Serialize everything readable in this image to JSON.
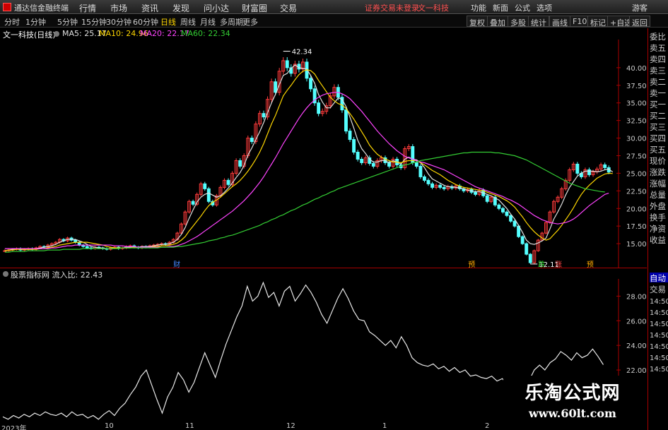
{
  "app": {
    "title": "通达信金融终端",
    "menu": [
      "行情",
      "市场",
      "资讯",
      "发现",
      "问小达",
      "财富圈",
      "交易"
    ],
    "notice": "证券交易未登录",
    "stock_tab": "文一科技",
    "right_menu": [
      "功能",
      "新面",
      "公式",
      "选项"
    ],
    "guest": "游客"
  },
  "toolbar": {
    "periods": [
      "分时",
      "1分钟",
      "5分钟",
      "15分钟",
      "30分钟",
      "60分钟",
      "日线",
      "周线",
      "月线",
      "多周期",
      "更多"
    ],
    "active_period": "日线",
    "buttons": [
      "复权",
      "叠加",
      "多股",
      "统计",
      "画线",
      "F10",
      "标记",
      "+自选",
      "返回"
    ]
  },
  "stock": {
    "name": "文一科技(日线)",
    "ma": [
      {
        "label": "MA5: 25.17",
        "color": "#e0e0e0"
      },
      {
        "label": "MA10: 24.96",
        "color": "#ffd700"
      },
      {
        "label": "MA20: 22.17",
        "color": "#ff44ff"
      },
      {
        "label": "MA60: 22.34",
        "color": "#33cc33"
      }
    ],
    "high_label": "42.34",
    "low_label": "12.11",
    "markers": [
      "财",
      "预",
      "跌",
      "涨",
      "预"
    ]
  },
  "indicator": {
    "header": "股票指标网 流入比: 22.43",
    "y_ticks": [
      "28.00",
      "26.00",
      "24.00",
      "22.00"
    ]
  },
  "right_panel": {
    "items": [
      "委比",
      "卖五",
      "卖四",
      "卖三",
      "卖二",
      "卖一",
      "买一",
      "买二",
      "买三",
      "买四",
      "买五",
      "现价",
      "涨跌",
      "涨幅",
      "总量",
      "外盘",
      "换手",
      "净资",
      "收益"
    ],
    "bottom_items": [
      "自动",
      "交易"
    ],
    "times": [
      "14:50",
      "14:50",
      "14:50",
      "14:50",
      "14:50",
      "14:50",
      "14:50"
    ]
  },
  "dates": [
    "2023年",
    "10",
    "11",
    "12",
    "1",
    "2"
  ],
  "watermark": {
    "title": "乐淘公式网",
    "url": "www.60lt.com"
  },
  "chart_data": [
    {
      "type": "candlestick",
      "title": "文一科技(日线)",
      "y_ticks": [
        15.0,
        17.5,
        20.0,
        22.5,
        25.0,
        27.5,
        30.0,
        32.5,
        35.0,
        37.5,
        40.0
      ],
      "ylim": [
        11.5,
        44.0
      ],
      "annotations": [
        {
          "text": "42.34",
          "y": 42.34
        },
        {
          "text": "12.11",
          "y": 12.11
        }
      ],
      "closes": [
        14.0,
        14.1,
        14.2,
        14.3,
        14.1,
        14.2,
        14.3,
        14.2,
        14.4,
        14.6,
        14.5,
        14.8,
        15.0,
        15.2,
        15.6,
        15.4,
        15.8,
        15.5,
        15.2,
        14.8,
        14.6,
        14.4,
        14.3,
        14.5,
        14.4,
        14.3,
        14.2,
        14.4,
        14.5,
        14.3,
        14.4,
        14.6,
        14.7,
        14.5,
        14.4,
        14.6,
        14.5,
        14.7,
        14.8,
        14.9,
        15.0,
        14.9,
        15.2,
        15.6,
        16.5,
        17.8,
        19.5,
        21.0,
        20.6,
        22.0,
        23.5,
        22.8,
        21.0,
        20.5,
        21.8,
        23.0,
        24.0,
        23.4,
        25.0,
        26.8,
        26.0,
        27.5,
        30.0,
        29.5,
        32.0,
        33.5,
        33.0,
        35.5,
        38.0,
        36.5,
        39.5,
        41.0,
        40.0,
        39.2,
        40.5,
        39.8,
        40.8,
        38.5,
        37.0,
        35.0,
        33.5,
        33.8,
        34.6,
        36.0,
        37.2,
        35.8,
        34.0,
        31.0,
        29.8,
        28.0,
        27.0,
        26.5,
        27.2,
        26.4,
        26.0,
        26.8,
        27.2,
        26.5,
        26.0,
        27.0,
        26.2,
        25.8,
        28.5,
        28.8,
        26.5,
        26.0,
        24.5,
        24.0,
        23.5,
        23.0,
        23.3,
        23.0,
        22.8,
        23.1,
        22.9,
        23.2,
        22.8,
        22.5,
        22.7,
        22.3,
        22.0,
        22.6,
        21.8,
        21.0,
        21.6,
        20.5,
        20.0,
        19.5,
        19.0,
        18.2,
        17.5,
        16.0,
        15.0,
        13.5,
        12.3,
        14.0,
        15.5,
        16.5,
        18.0,
        19.5,
        21.0,
        21.6,
        22.8,
        24.0,
        25.5,
        26.3,
        25.0,
        24.5,
        25.5,
        24.8,
        25.2,
        25.6,
        26.2,
        25.8,
        25.17
      ],
      "series": [
        {
          "name": "MA5",
          "values": [
            14.0,
            14.1,
            14.2,
            14.3,
            14.2,
            14.2,
            14.2,
            14.2,
            14.3,
            14.4,
            14.5,
            14.6,
            14.7,
            14.9,
            15.2,
            15.4,
            15.6,
            15.6,
            15.6,
            15.4,
            15.2,
            14.9,
            14.6,
            14.5,
            14.4,
            14.4,
            14.3,
            14.3,
            14.4,
            14.4,
            14.4,
            14.5,
            14.5,
            14.5,
            14.5,
            14.6,
            14.6,
            14.6,
            14.7,
            14.8,
            14.9,
            14.9,
            15.0,
            15.2,
            15.6,
            16.3,
            17.3,
            18.6,
            19.8,
            20.9,
            21.6,
            22.0,
            22.2,
            21.9,
            21.6,
            21.8,
            22.3,
            22.9,
            23.6,
            24.4,
            25.1,
            26.1,
            27.6,
            28.6,
            29.8,
            30.9,
            32.2,
            33.6,
            35.0,
            36.2,
            37.6,
            38.9,
            39.2,
            39.9,
            40.4,
            40.0,
            39.9,
            39.8,
            38.9,
            37.8,
            36.2,
            35.1,
            34.3,
            34.3,
            35.0,
            35.7,
            35.5,
            34.5,
            33.0,
            31.4,
            29.7,
            28.5,
            27.8,
            27.0,
            26.6,
            26.6,
            26.8,
            26.8,
            26.5,
            26.8,
            26.6,
            26.3,
            27.0,
            27.3,
            27.0,
            26.9,
            26.5,
            25.8,
            24.9,
            24.2,
            23.9,
            23.6,
            23.3,
            23.1,
            23.1,
            23.0,
            22.9,
            22.8,
            22.6,
            22.5,
            22.4,
            22.4,
            22.2,
            22.0,
            21.8,
            21.5,
            21.2,
            20.6,
            20.0,
            19.2,
            18.5,
            17.6,
            16.6,
            15.5,
            15.0,
            14.9,
            15.1,
            15.4,
            15.8,
            17.1,
            18.5,
            19.5,
            20.6,
            21.9,
            23.0,
            23.8,
            24.6,
            25.0,
            25.3,
            25.3,
            25.3,
            25.2,
            25.3,
            25.5,
            25.6,
            25.17
          ]
        },
        {
          "name": "MA10",
          "values": [
            14.0,
            14.1,
            14.1,
            14.2,
            14.2,
            14.2,
            14.2,
            14.2,
            14.2,
            14.3,
            14.3,
            14.4,
            14.5,
            14.6,
            14.8,
            14.9,
            15.0,
            15.1,
            15.2,
            15.2,
            15.2,
            15.2,
            15.1,
            15.0,
            14.9,
            14.8,
            14.6,
            14.5,
            14.4,
            14.4,
            14.4,
            14.4,
            14.4,
            14.5,
            14.5,
            14.5,
            14.5,
            14.5,
            14.6,
            14.6,
            14.7,
            14.7,
            14.8,
            14.9,
            15.1,
            15.5,
            16.0,
            16.8,
            17.5,
            18.2,
            18.9,
            19.7,
            20.4,
            20.9,
            21.2,
            21.6,
            22.1,
            22.6,
            23.1,
            23.5,
            24.0,
            24.6,
            25.3,
            26.1,
            27.0,
            28.0,
            29.2,
            30.6,
            32.0,
            33.2,
            34.6,
            36.0,
            36.8,
            37.5,
            38.3,
            39.0,
            39.5,
            39.7,
            39.6,
            39.1,
            38.2,
            37.4,
            36.6,
            35.8,
            35.3,
            34.9,
            34.7,
            34.2,
            33.5,
            32.7,
            31.8,
            30.9,
            30.0,
            29.0,
            28.3,
            27.7,
            27.3,
            27.0,
            26.8,
            26.6,
            26.6,
            26.5,
            26.7,
            26.8,
            26.8,
            26.8,
            26.5,
            26.2,
            25.8,
            25.4,
            25.1,
            24.8,
            24.4,
            24.0,
            23.7,
            23.4,
            23.2,
            23.0,
            22.9,
            22.8,
            22.7,
            22.6,
            22.5,
            22.3,
            22.1,
            21.9,
            21.7,
            21.4,
            21.1,
            20.7,
            20.2,
            19.5,
            18.8,
            18.0,
            17.3,
            16.7,
            16.2,
            15.8,
            15.5,
            15.7,
            16.3,
            16.9,
            17.6,
            18.4,
            19.2,
            20.1,
            21.1,
            22.0,
            22.7,
            23.3,
            23.8,
            24.3,
            24.6,
            24.9,
            25.0,
            24.96
          ]
        },
        {
          "name": "MA20",
          "values": [
            14.3,
            14.3,
            14.3,
            14.3,
            14.3,
            14.3,
            14.3,
            14.3,
            14.3,
            14.3,
            14.3,
            14.3,
            14.4,
            14.4,
            14.5,
            14.6,
            14.7,
            14.7,
            14.8,
            14.8,
            14.8,
            14.8,
            14.8,
            14.8,
            14.8,
            14.8,
            14.8,
            14.8,
            14.7,
            14.7,
            14.7,
            14.6,
            14.6,
            14.6,
            14.5,
            14.5,
            14.5,
            14.5,
            14.5,
            14.5,
            14.5,
            14.5,
            14.6,
            14.6,
            14.7,
            14.9,
            15.1,
            15.4,
            15.7,
            16.0,
            16.4,
            16.8,
            17.2,
            17.6,
            18.0,
            18.4,
            18.8,
            19.2,
            19.6,
            20.1,
            20.6,
            21.1,
            21.7,
            22.3,
            23.0,
            23.7,
            24.5,
            25.4,
            26.3,
            27.2,
            28.2,
            29.2,
            30.1,
            31.0,
            31.9,
            32.8,
            33.6,
            34.3,
            34.9,
            35.4,
            35.8,
            36.1,
            36.3,
            36.4,
            36.5,
            36.5,
            36.3,
            36.0,
            35.6,
            35.0,
            34.4,
            33.8,
            33.1,
            32.4,
            31.7,
            31.0,
            30.4,
            29.8,
            29.2,
            28.7,
            28.2,
            27.8,
            27.4,
            27.2,
            27.0,
            26.8,
            26.6,
            26.5,
            26.3,
            26.1,
            25.9,
            25.7,
            25.5,
            25.2,
            24.9,
            24.6,
            24.3,
            24.0,
            23.7,
            23.4,
            23.1,
            22.9,
            22.7,
            22.5,
            22.3,
            22.1,
            21.9,
            21.7,
            21.4,
            21.2,
            20.9,
            20.6,
            20.2,
            19.8,
            19.4,
            19.0,
            18.7,
            18.4,
            18.2,
            18.0,
            17.9,
            17.8,
            17.9,
            18.0,
            18.2,
            18.5,
            18.9,
            19.4,
            19.9,
            20.4,
            20.8,
            21.2,
            21.6,
            22.0,
            22.17
          ]
        },
        {
          "name": "MA60",
          "values": [
            13.8,
            13.8,
            13.9,
            13.9,
            13.9,
            13.9,
            14.0,
            14.0,
            14.0,
            14.0,
            14.0,
            14.1,
            14.1,
            14.1,
            14.1,
            14.2,
            14.2,
            14.2,
            14.2,
            14.2,
            14.3,
            14.3,
            14.3,
            14.3,
            14.3,
            14.3,
            14.3,
            14.3,
            14.3,
            14.3,
            14.4,
            14.4,
            14.4,
            14.4,
            14.4,
            14.4,
            14.4,
            14.4,
            14.4,
            14.4,
            14.5,
            14.5,
            14.5,
            14.5,
            14.6,
            14.6,
            14.7,
            14.8,
            14.9,
            15.0,
            15.1,
            15.2,
            15.4,
            15.5,
            15.6,
            15.8,
            15.9,
            16.1,
            16.2,
            16.4,
            16.6,
            16.8,
            17.0,
            17.2,
            17.4,
            17.6,
            17.9,
            18.1,
            18.4,
            18.6,
            18.9,
            19.1,
            19.4,
            19.7,
            19.9,
            20.2,
            20.5,
            20.7,
            21.0,
            21.3,
            21.5,
            21.8,
            22.0,
            22.3,
            22.5,
            22.8,
            23.0,
            23.2,
            23.4,
            23.6,
            23.8,
            24.0,
            24.2,
            24.4,
            24.6,
            24.8,
            25.0,
            25.2,
            25.4,
            25.6,
            25.8,
            26.0,
            26.2,
            26.3,
            26.5,
            26.6,
            26.8,
            26.9,
            27.0,
            27.1,
            27.2,
            27.3,
            27.4,
            27.5,
            27.6,
            27.7,
            27.8,
            27.9,
            27.9,
            28.0,
            28.0,
            28.0,
            28.0,
            28.0,
            28.0,
            27.9,
            27.9,
            27.8,
            27.7,
            27.6,
            27.5,
            27.3,
            27.1,
            26.9,
            26.6,
            26.3,
            26.0,
            25.7,
            25.4,
            25.1,
            24.8,
            24.5,
            24.2,
            23.9,
            23.6,
            23.4,
            23.2,
            23.0,
            22.8,
            22.7,
            22.6,
            22.5,
            22.4,
            22.34
          ]
        }
      ]
    },
    {
      "type": "line",
      "title": "流入比",
      "y_ticks": [
        22.0,
        24.0,
        26.0,
        28.0
      ],
      "ylim": [
        17.7,
        29.4
      ],
      "series": [
        {
          "name": "流入比",
          "values": [
            18.2,
            18.0,
            18.3,
            18.1,
            18.4,
            18.2,
            18.5,
            18.3,
            18.6,
            18.4,
            18.3,
            18.5,
            18.2,
            18.6,
            18.3,
            18.4,
            18.1,
            18.3,
            18.0,
            18.4,
            18.7,
            18.3,
            18.9,
            19.3,
            20.0,
            20.6,
            21.5,
            22.0,
            20.8,
            19.6,
            18.5,
            19.8,
            20.6,
            21.8,
            21.2,
            20.2,
            21.0,
            22.2,
            23.4,
            22.4,
            21.4,
            22.8,
            24.1,
            25.2,
            26.3,
            27.2,
            28.8,
            27.6,
            28.0,
            29.1,
            27.9,
            28.3,
            27.2,
            28.4,
            28.8,
            27.6,
            28.2,
            28.9,
            28.3,
            27.5,
            26.5,
            25.8,
            26.8,
            27.8,
            28.6,
            27.8,
            26.8,
            26.1,
            26.0,
            25.1,
            24.8,
            24.4,
            24.0,
            24.4,
            23.8,
            24.7,
            24.0,
            23.0,
            22.6,
            22.4,
            22.3,
            22.5,
            22.1,
            22.3,
            21.9,
            22.2,
            21.8,
            22.0,
            21.5,
            21.6,
            21.4,
            21.3,
            21.5,
            21.1,
            21.3,
            20.8,
            21.1,
            20.7,
            20.8,
            21.1,
            22.0,
            22.4,
            22.0,
            22.6,
            22.9,
            23.5,
            23.2,
            22.8,
            23.4,
            23.0,
            23.2,
            23.7,
            23.1,
            22.43
          ]
        }
      ]
    }
  ]
}
